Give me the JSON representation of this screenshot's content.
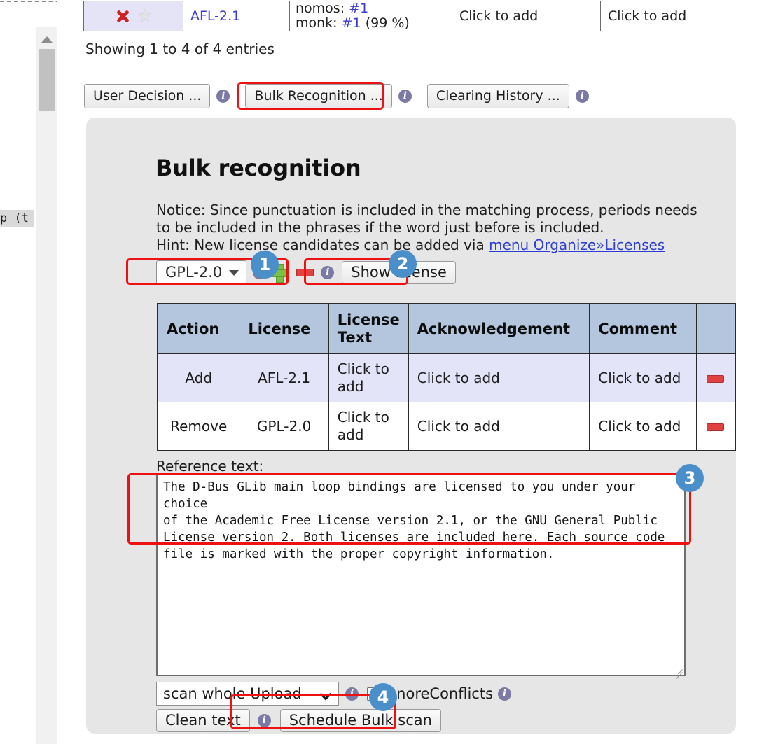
{
  "left_strip": {
    "clipped_text": "p (t",
    "scroll_up_icon": "triangle-up-icon"
  },
  "results_table": {
    "row": {
      "action_icons": [
        "x-icon",
        "star-icon"
      ],
      "license": "AFL-2.1",
      "agent_line1_label": "nomos:",
      "agent_line1_value": "#1",
      "agent_line2_label": "monk:",
      "agent_line2_value": "#1",
      "agent_line2_suffix": "(99 %)",
      "acknowledgement": "Click to add",
      "comment": "Click to add"
    },
    "showing": "Showing 1 to 4 of 4 entries"
  },
  "tabs": [
    {
      "label": "User Decision ...",
      "active": false
    },
    {
      "label": "Bulk Recognition ...",
      "active": true
    },
    {
      "label": "Clearing History ...",
      "active": false
    }
  ],
  "panel": {
    "title": "Bulk recognition",
    "notice_line1": "Notice: Since punctuation is included in the matching process, periods needs",
    "notice_line2": "to be included in the phrases if the word just before is included.",
    "hint_prefix": "Hint: New license candidates can be added via ",
    "hint_link": "menu Organize»Licenses",
    "license_select": {
      "value": "GPL-2.0",
      "caret": "chevron-down-icon"
    },
    "add_icon": "plus-icon",
    "remove_icon": "minus-icon",
    "show_license_label": "Show license",
    "table": {
      "headers": [
        "Action",
        "License",
        "License Text",
        "Acknowledgement",
        "Comment",
        ""
      ],
      "rows": [
        {
          "action": "Add",
          "license": "AFL-2.1",
          "license_text": "Click to add",
          "acknowledgement": "Click to add",
          "comment": "Click to add",
          "delete_icon": "minus-icon"
        },
        {
          "action": "Remove",
          "license": "GPL-2.0",
          "license_text": "Click to add",
          "acknowledgement": "Click to add",
          "comment": "Click to add",
          "delete_icon": "minus-icon"
        }
      ]
    },
    "reference": {
      "label": "Reference text:",
      "value": "The D-Bus GLib main loop bindings are licensed to you under your choice\nof the Academic Free License version 2.1, or the GNU General Public\nLicense version 2. Both licenses are included here. Each source code\nfile is marked with the proper copyright information."
    },
    "scan_scope": {
      "value": "scan whole Upload",
      "caret": "chevron-down-icon"
    },
    "ignore_conflicts_label": "ignoreConflicts",
    "clean_text_label": "Clean text",
    "schedule_label": "Schedule Bulk scan"
  },
  "annotations": {
    "badges": [
      "1",
      "2",
      "3",
      "4"
    ],
    "highlight_color": "#ee1111",
    "badge_color": "#4a8fca"
  },
  "icons": {
    "info": "info-icon"
  }
}
